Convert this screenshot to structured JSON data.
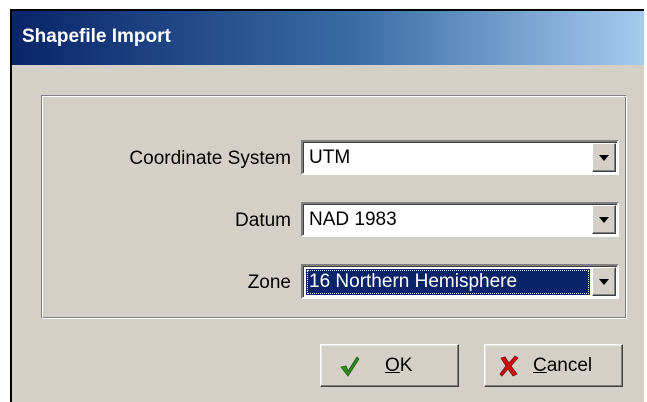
{
  "dialog": {
    "title": "Shapefile Import"
  },
  "fields": {
    "coordinate_system": {
      "label": "Coordinate System",
      "value": "UTM"
    },
    "datum": {
      "label": "Datum",
      "value": "NAD 1983"
    },
    "zone": {
      "label": "Zone",
      "value": "16 Northern Hemisphere"
    }
  },
  "buttons": {
    "ok": {
      "label": "OK",
      "icon": "checkmark-icon",
      "icon_color": "#2e8b1f"
    },
    "cancel": {
      "label": "Cancel",
      "icon": "x-icon",
      "icon_color": "#cc1010"
    }
  },
  "colors": {
    "title_start": "#0a246a",
    "title_end": "#a6caf0",
    "selection": "#0a246a",
    "face": "#d4d0c8"
  }
}
